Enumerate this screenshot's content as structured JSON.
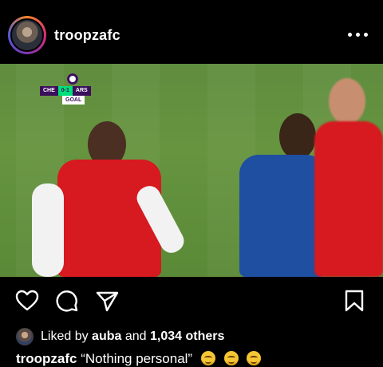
{
  "post": {
    "username": "troopzafc",
    "menu_icon": "more-horizontal-icon"
  },
  "media": {
    "scorebug": {
      "home": "CHE",
      "score": "0-1",
      "away": "ARS",
      "status": "GOAL"
    },
    "colors": {
      "pitch": "#5f8d3e",
      "arsenal_red": "#d71920",
      "chelsea_blue": "#1f4fa0",
      "scorebug_purple": "#3b0f5c",
      "scorebug_green": "#00e07a"
    }
  },
  "actions": {
    "like_icon": "heart-icon",
    "comment_icon": "comment-icon",
    "share_icon": "send-icon",
    "save_icon": "bookmark-icon"
  },
  "likes": {
    "prefix": "Liked by",
    "first_user": "auba",
    "joiner": "and",
    "others": "1,034 others"
  },
  "caption": {
    "username": "troopzafc",
    "text": "“Nothing personal”",
    "emoji": [
      "smiling-face",
      "smiling-face",
      "smiling-face"
    ]
  }
}
